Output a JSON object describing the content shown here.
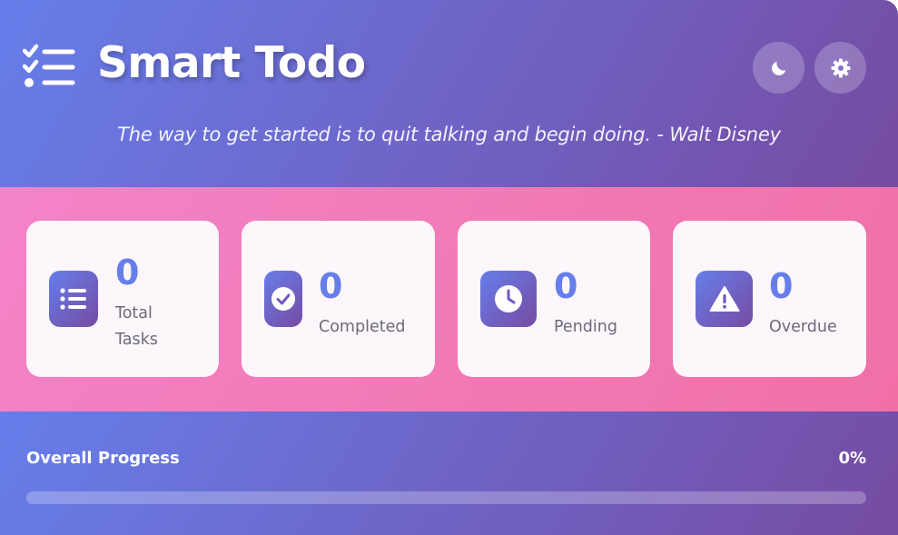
{
  "header": {
    "title": "Smart Todo",
    "logo_icon": "checklist-icon",
    "quote": "The way to get started is to quit talking and begin doing. - Walt Disney",
    "buttons": [
      {
        "name": "theme-toggle-button",
        "icon": "moon-icon"
      },
      {
        "name": "settings-button",
        "icon": "gear-icon"
      }
    ]
  },
  "stats": [
    {
      "value": "0",
      "label": "Total Tasks",
      "icon": "list-icon"
    },
    {
      "value": "0",
      "label": "Completed",
      "icon": "check-circle-icon"
    },
    {
      "value": "0",
      "label": "Pending",
      "icon": "clock-icon"
    },
    {
      "value": "0",
      "label": "Overdue",
      "icon": "warning-icon"
    }
  ],
  "progress": {
    "label": "Overall Progress",
    "percent_text": "0%",
    "percent": 0
  },
  "colors": {
    "header_gradient_start": "#667eea",
    "header_gradient_end": "#764ba2",
    "stats_bg_start": "#f384c8",
    "stats_bg_end": "#f070a6",
    "accent": "#667eea",
    "card_bg": "#fdf6fa"
  }
}
